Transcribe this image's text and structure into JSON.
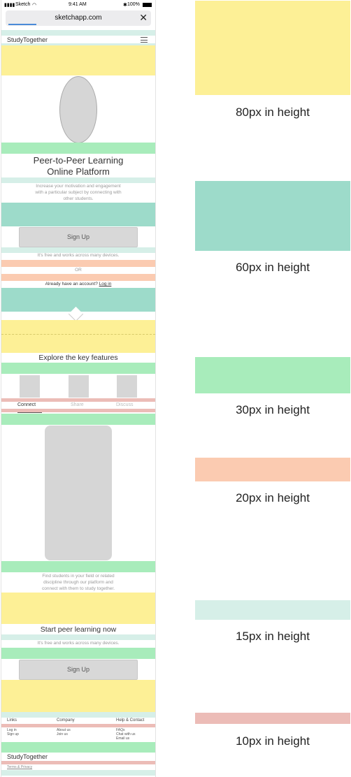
{
  "statusbar": {
    "carrier": "Sketch",
    "time": "9:41 AM",
    "battery": "100%"
  },
  "browser": {
    "url": "sketchapp.com",
    "close_icon": "close-icon"
  },
  "header": {
    "brand": "StudyTogether",
    "menu_icon": "hamburger-icon"
  },
  "hero": {
    "title_line1": "Peer-to-Peer Learning",
    "title_line2": "Online Platform",
    "desc_line1": "Increase your motivation and engagement",
    "desc_line2": "with a particular subject by connecting with",
    "desc_line3": "other students.",
    "signup_label": "Sign Up",
    "free_note": "It's free and works across many devices.",
    "or_label": "OR",
    "account_prompt": "Already have an account?",
    "login_link": "Log in"
  },
  "features": {
    "title": "Explore the key features",
    "tabs": [
      {
        "label": "Connect",
        "active": true
      },
      {
        "label": "Share",
        "active": false
      },
      {
        "label": "Discuss",
        "active": false
      }
    ],
    "desc_line1": "Find students in your field or related",
    "desc_line2": "discipline through our platform and",
    "desc_line3": "connect with them to study together."
  },
  "cta": {
    "title": "Start peer learning now",
    "free_note": "It's free and works across many devices.",
    "signup_label": "Sign Up"
  },
  "footer": {
    "columns": [
      {
        "heading": "Links",
        "links": [
          "Log in",
          "Sign up"
        ]
      },
      {
        "heading": "Company",
        "links": [
          "About us",
          "Join us"
        ]
      },
      {
        "heading": "Help & Contact",
        "links": [
          "FAQs",
          "Chat with us",
          "Email us"
        ]
      }
    ],
    "brand": "StudyTogether",
    "terms": "Terms & Privacy"
  },
  "legend": [
    {
      "label": "80px in height",
      "color": "#fdf096"
    },
    {
      "label": "60px in height",
      "color": "#9ddbca"
    },
    {
      "label": "30px in height",
      "color": "#a8ecbb"
    },
    {
      "label": "20px in height",
      "color": "#fbcbb1"
    },
    {
      "label": "15px in height",
      "color": "#d6efe8"
    },
    {
      "label": "10px in height",
      "color": "#ecbcb7"
    }
  ]
}
